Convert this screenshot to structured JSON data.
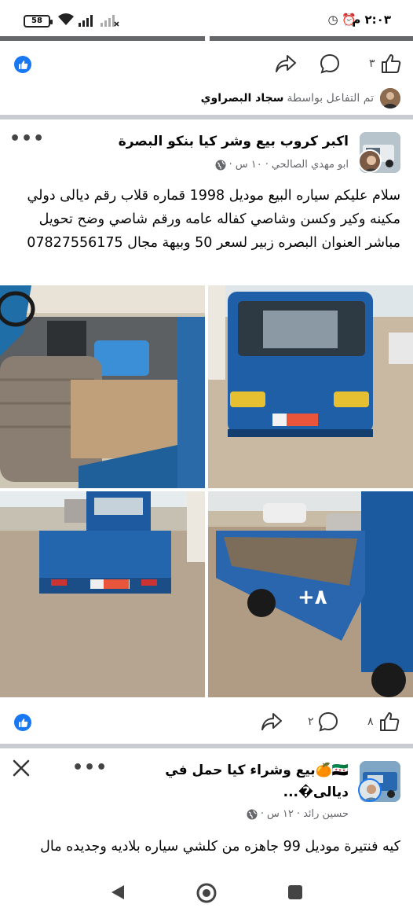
{
  "status_bar": {
    "time": "٢:٠٣ م",
    "battery": "58",
    "alarm_icon": "alarm-icon",
    "clock_icon": "clock-icon"
  },
  "post1_actions": {
    "like_count": "٣",
    "reaction_icon": "like-bubble-icon"
  },
  "reacted": {
    "prefix": "تم التفاعل بواسطة",
    "name": "سجاد البصراوي"
  },
  "post2": {
    "group_name": "اكبر كروب بيع وشر كيا بنكو البصرة",
    "author": "ابو مهدي الصالحي",
    "time": "١٠ س",
    "text": "سلام عليكم سياره البيع موديل 1998 قماره قلاب رقم ديالى دولي مكينه وكير وكسن وشاصي كفاله عامه ورقم شاصي وضح تحويل مباشر العنوان البصره زبير لسعر 50 وبيهة مجال 07827556175",
    "more_photos": "+٨",
    "like_count": "٨",
    "comment_count": "٢"
  },
  "post3": {
    "group_name": "🇸🇾🍊بيع وشراء كيا حمل في ديالى�...",
    "author": "حسين رائد",
    "time": "١٢ س",
    "text": "كيه فنتيرة موديل 99 جاهزه من كلشي سياره بلاديه وجديده مال"
  },
  "colors": {
    "facebook_blue": "#1877f2",
    "secondary_text": "#65676b"
  }
}
